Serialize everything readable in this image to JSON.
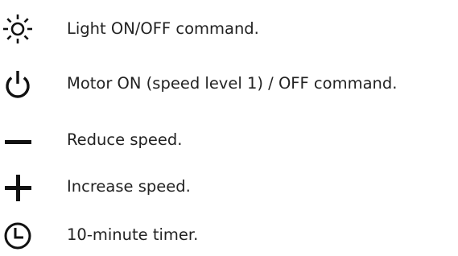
{
  "commands": [
    {
      "icon": "sun-light-icon",
      "label": "Light ON/OFF command."
    },
    {
      "icon": "power-icon",
      "label": "Motor ON (speed level 1) / OFF command."
    },
    {
      "icon": "minus-icon",
      "label": "Reduce speed."
    },
    {
      "icon": "plus-icon",
      "label": "Increase speed."
    },
    {
      "icon": "clock-timer-icon",
      "label": "10-minute timer."
    }
  ],
  "icon_color": "#111111",
  "text_color": "#222222"
}
